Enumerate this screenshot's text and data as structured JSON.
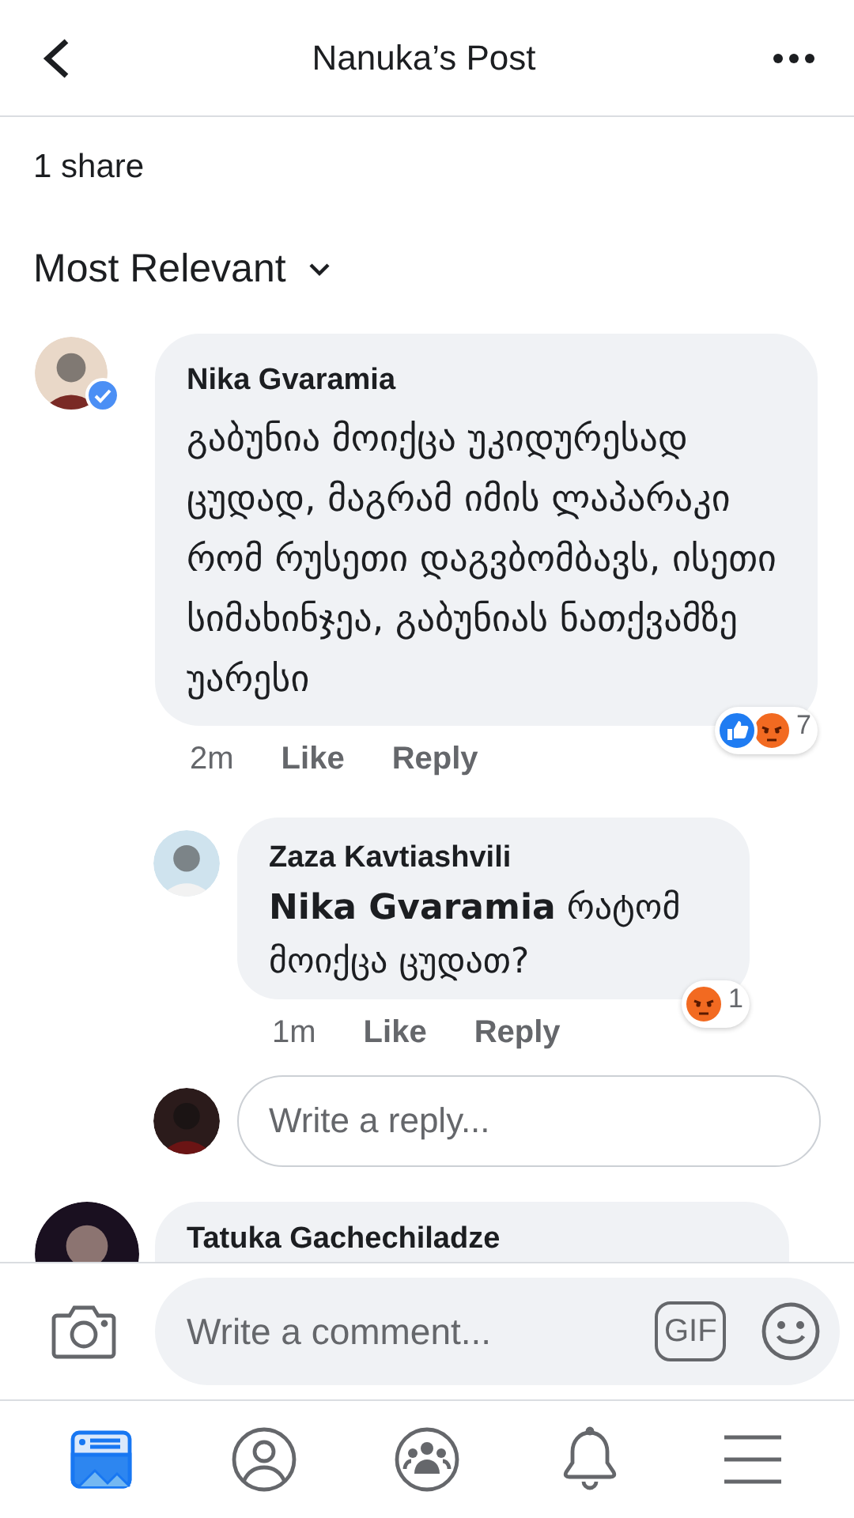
{
  "header": {
    "title": "Nanuka’s Post"
  },
  "shares": "1 share",
  "sort": {
    "label": "Most Relevant"
  },
  "comments": [
    {
      "author": "Nika Gvaramia",
      "verified": true,
      "text": "გაბუნია მოიქცა უკიდურესად ცუდად, მაგრამ იმის ლაპარაკი რომ რუსეთი დაგვბომბავს, ისეთი სიმახინჯეა, გაბუნიას ნათქვამზე უარესი",
      "time": "2m",
      "like": "Like",
      "reply": "Reply",
      "reactions": [
        {
          "kind": "like"
        },
        {
          "kind": "angry"
        }
      ],
      "reaction_count": "7",
      "replies": [
        {
          "author": "Zaza Kavtiashvili",
          "text": "**Nika Gvaramia** რატომ მოიქცა ცუდათ?",
          "time": "1m",
          "like": "Like",
          "reply": "Reply",
          "reactions": [
            {
              "kind": "angry"
            }
          ],
          "reaction_count": "1"
        }
      ],
      "reply_field": {
        "placeholder": "Write a reply..."
      }
    },
    {
      "author": "Tatuka Gachechiladze"
    }
  ],
  "composer": {
    "placeholder": "Write a comment...",
    "gif": "GIF"
  },
  "nav": [
    {
      "kind": "feed",
      "selected": true
    },
    {
      "kind": "profile",
      "selected": false
    },
    {
      "kind": "groups",
      "selected": false
    },
    {
      "kind": "notifications",
      "selected": false
    },
    {
      "kind": "menu",
      "selected": false
    }
  ]
}
